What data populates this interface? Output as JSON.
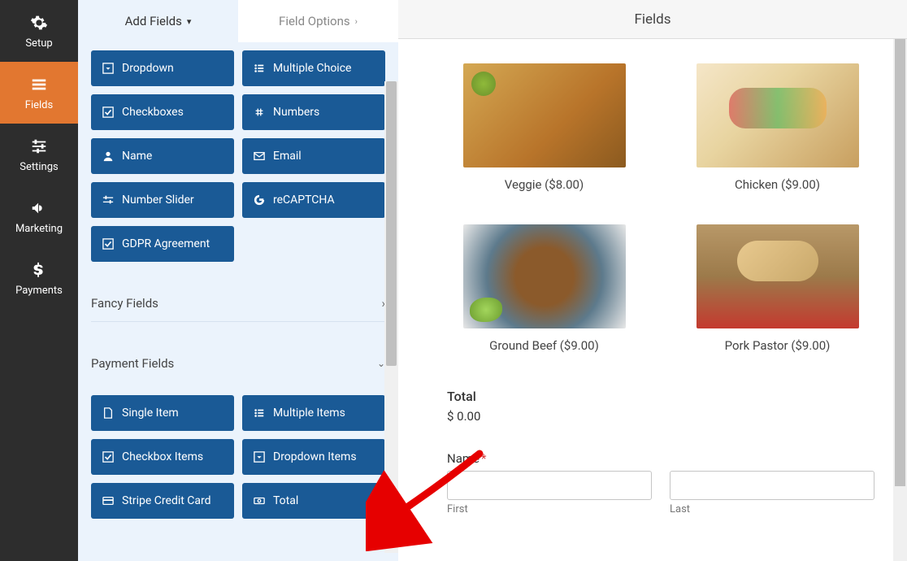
{
  "sidebar": {
    "items": [
      {
        "label": "Setup"
      },
      {
        "label": "Fields"
      },
      {
        "label": "Settings"
      },
      {
        "label": "Marketing"
      },
      {
        "label": "Payments"
      }
    ]
  },
  "tabs": {
    "add_fields": "Add Fields",
    "field_options": "Field Options"
  },
  "fields": {
    "dropdown": "Dropdown",
    "multiple_choice": "Multiple Choice",
    "checkboxes": "Checkboxes",
    "numbers": "Numbers",
    "name": "Name",
    "email": "Email",
    "number_slider": "Number Slider",
    "recaptcha": "reCAPTCHA",
    "gdpr": "GDPR Agreement"
  },
  "sections": {
    "fancy": "Fancy Fields",
    "payment": "Payment Fields"
  },
  "payment_fields": {
    "single_item": "Single Item",
    "multiple_items": "Multiple Items",
    "checkbox_items": "Checkbox Items",
    "dropdown_items": "Dropdown Items",
    "stripe": "Stripe Credit Card",
    "total": "Total"
  },
  "header": {
    "title": "Fields"
  },
  "products": [
    {
      "label": "Veggie ($8.00)"
    },
    {
      "label": "Chicken ($9.00)"
    },
    {
      "label": "Ground Beef ($9.00)"
    },
    {
      "label": "Pork Pastor ($9.00)"
    }
  ],
  "total": {
    "label": "Total",
    "value": "$ 0.00"
  },
  "name_field": {
    "label": "Name",
    "required_mark": "*",
    "first_sub": "First",
    "last_sub": "Last"
  }
}
